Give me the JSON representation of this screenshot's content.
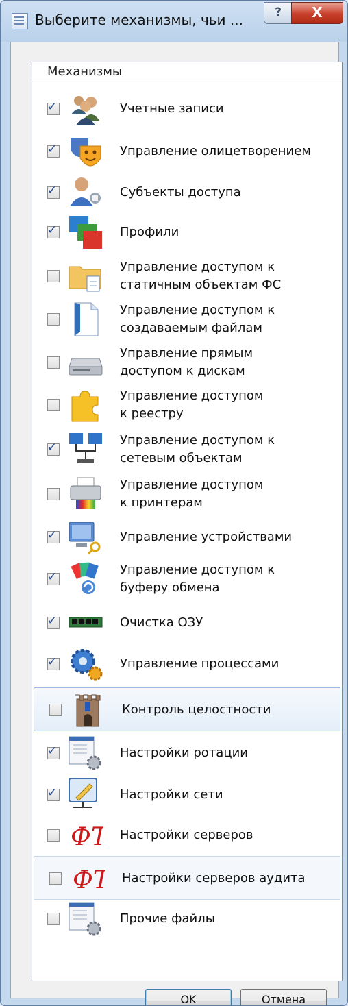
{
  "window": {
    "title": "Выберите механизмы, чьи ...",
    "help_glyph": "?",
    "close_glyph": "X"
  },
  "list": {
    "header": "Механизмы",
    "items": [
      {
        "icon": "users-icon",
        "checked": true,
        "line1": "Учетные записи",
        "line2": ""
      },
      {
        "icon": "theater-masks-icon",
        "checked": true,
        "line1": "Управление олицетворением",
        "line2": ""
      },
      {
        "icon": "user-wrench-icon",
        "checked": true,
        "line1": "Субъекты доступа",
        "line2": ""
      },
      {
        "icon": "profiles-icon",
        "checked": true,
        "line1": "Профили",
        "line2": ""
      },
      {
        "icon": "folder-file-icon",
        "checked": false,
        "line1": "Управление доступом к",
        "line2": "статичным объектам ФС"
      },
      {
        "icon": "new-file-icon",
        "checked": false,
        "line1": "Управление доступом к",
        "line2": "создаваемым файлам"
      },
      {
        "icon": "disk-drive-icon",
        "checked": false,
        "line1": "Управление прямым",
        "line2": "доступом к дискам"
      },
      {
        "icon": "puzzle-icon",
        "checked": false,
        "line1": "Управление доступом",
        "line2": "к реестру"
      },
      {
        "icon": "network-icon",
        "checked": true,
        "line1": "Управление доступом к",
        "line2": "сетевым объектам"
      },
      {
        "icon": "printer-icon",
        "checked": false,
        "line1": "Управление доступом",
        "line2": "к принтерам"
      },
      {
        "icon": "computer-key-icon",
        "checked": true,
        "line1": "Управление устройствами",
        "line2": ""
      },
      {
        "icon": "clipboard-cards-icon",
        "checked": true,
        "line1": "Управление доступом к",
        "line2": "буферу обмена"
      },
      {
        "icon": "memory-module-icon",
        "checked": true,
        "line1": "Очистка ОЗУ",
        "line2": ""
      },
      {
        "icon": "gears-icon",
        "checked": true,
        "line1": "Управление процессами",
        "line2": ""
      },
      {
        "icon": "castle-tower-icon",
        "checked": false,
        "line1": "Контроль целостности",
        "line2": ""
      },
      {
        "icon": "settings-document-icon",
        "checked": true,
        "line1": "Настройки ротации",
        "line2": ""
      },
      {
        "icon": "network-pencil-icon",
        "checked": true,
        "line1": "Настройки сети",
        "line2": ""
      },
      {
        "icon": "server-logo-icon",
        "checked": false,
        "line1": "Настройки серверов",
        "line2": ""
      },
      {
        "icon": "server-logo-icon",
        "checked": false,
        "line1": "Настройки серверов аудита",
        "line2": ""
      },
      {
        "icon": "settings-document-icon",
        "checked": false,
        "line1": "Прочие файлы",
        "line2": ""
      }
    ]
  },
  "buttons": {
    "ok": "OK",
    "cancel": "Отмена"
  },
  "icon_logo_text": "ФТ"
}
